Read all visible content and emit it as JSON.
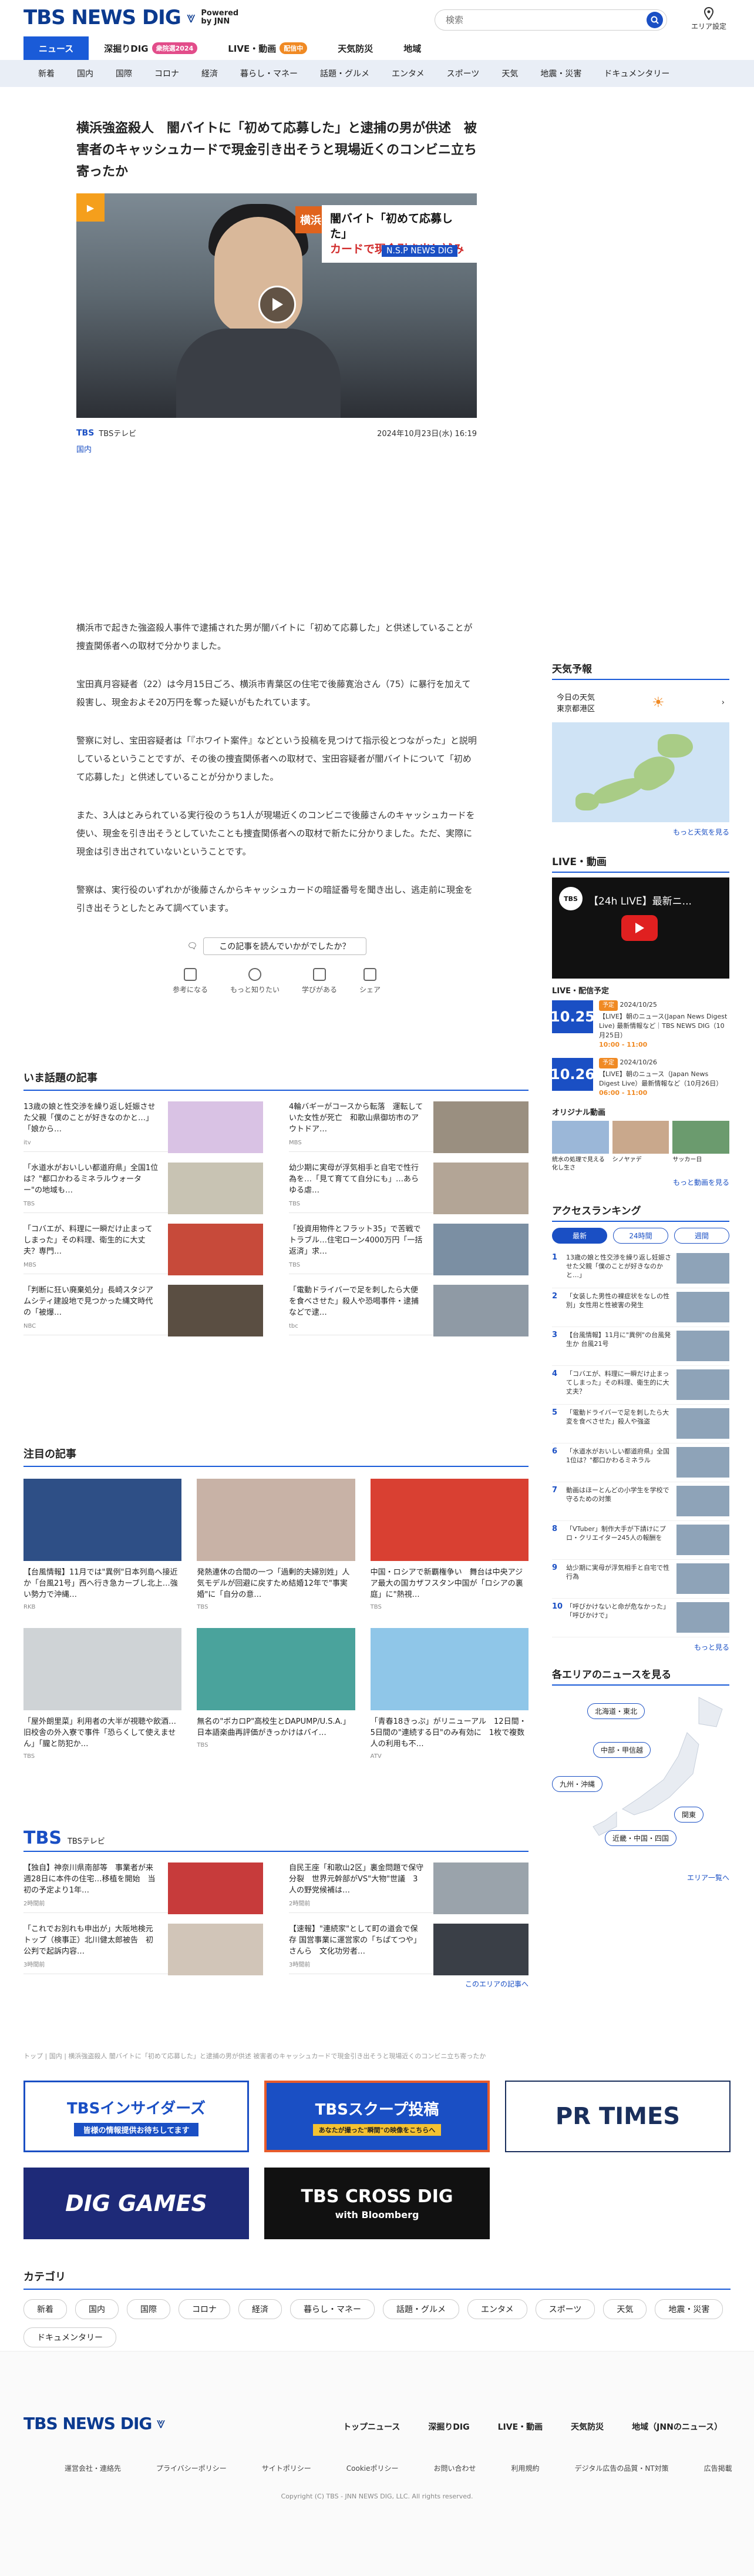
{
  "header": {
    "logo_text": "TBS NEWS DIG",
    "powered": "Powered by JNN",
    "search_placeholder": "検索",
    "area_label": "エリア設定"
  },
  "nav1": [
    {
      "label": "ニュース",
      "badge": ""
    },
    {
      "label": "深掘りDIG",
      "badge": "衆院選2024"
    },
    {
      "label": "LIVE・動画",
      "badge": "配信中"
    },
    {
      "label": "天気防災",
      "badge": ""
    },
    {
      "label": "地域",
      "badge": ""
    }
  ],
  "nav2": [
    "新着",
    "国内",
    "国際",
    "コロナ",
    "経済",
    "暮らし・マネー",
    "話題・グルメ",
    "エンタメ",
    "スポーツ",
    "天気",
    "地震・災害",
    "ドキュメンタリー"
  ],
  "article": {
    "title": "横浜強盗殺人　闇バイトに「初めて応募した」と逮捕の男が供述　被害者のキャッシュカードで現金引き出そうと現場近くのコンビニ立ち寄ったか",
    "hero_caption_line1": "闇バイト「初めて応募した」",
    "hero_caption_line2": "カードで現金引き出し試み",
    "hero_tag": "横浜",
    "hero_ntag": "N.S.P NEWS DIG",
    "source": "TBSテレビ",
    "date": "2024年10月23日(水) 16:19",
    "category": "国内",
    "paragraphs": [
      "横浜市で起きた強盗殺人事件で逮捕された男が闇バイトに「初めて応募した」と供述していることが捜査関係者への取材で分かりました。",
      "宝田真月容疑者（22）は今月15日ごろ、横浜市青葉区の住宅で後藤寛治さん（75）に暴行を加えて殺害し、現金およそ20万円を奪った疑いがもたれています。",
      "警察に対し、宝田容疑者は「『ホワイト案件』などという投稿を見つけて指示役とつながった」と説明しているということですが、その後の捜査関係者への取材で、宝田容疑者が闇バイトについて「初めて応募した」と供述していることが分かりました。",
      "また、3人はとみられている実行役のうち1人が現場近くのコンビニで後藤さんのキャッシュカードを使い、現金を引き出そうとしていたことも捜査関係者への取材で新たに分かりました。ただ、実際に現金は引き出されていないということです。",
      "警察は、実行役のいずれかが後藤さんからキャッシュカードの暗証番号を聞き出し、逃走前に現金を引き出そうとしたとみて調べています。"
    ],
    "feedback_q": "この記事を読んでいかがでしたか？",
    "feedback_opts": [
      "参考になる",
      "もっと知りたい",
      "学びがある",
      "シェア"
    ]
  },
  "sidebar": {
    "weather_h": "天気予報",
    "weather_today": "今日の天気",
    "weather_place": "東京都港区",
    "weather_more": "もっと天気を見る",
    "live_h": "LIVE・動画",
    "live_title": "【24h LIVE】最新ニ...",
    "live_logo": "TBS",
    "sched_h": "LIVE・配信予定",
    "sched": [
      {
        "day": "10.25",
        "pill": "予定",
        "date": "2024/10/25",
        "text": "【LIVE】朝のニュース(Japan News Digest Live) 最新情報など｜TBS NEWS DIG（10月25日）",
        "time": "10:00 - 11:00"
      },
      {
        "day": "10.26",
        "pill": "予定",
        "date": "2024/10/26",
        "text": "【LIVE】朝のニュース（Japan News Digest Live）最新情報など（10月26日）",
        "time": "06:00 - 11:00"
      }
    ],
    "orig_h": "オリジナル動画",
    "orig_caps": [
      "統水の処理で見える化し生さ",
      "シノヤァデ",
      "サッカー日"
    ],
    "orig_more": "もっと動画を見る",
    "rank_h": "アクセスランキング",
    "rank_tabs": [
      "最新",
      "24時間",
      "週間"
    ],
    "rank": [
      "13歳の娘と性交渉を繰り返し妊娠させた父親「僕のことが好きなのかと…」",
      "「女装した男性の裸症状をなしの性別」女性用と性被害の発生",
      "【台風情報】11月に\"異例\"の台風発生か 台風21号",
      "「コバエが、料理に一瞬だけ止まってしまった」その料理、衛生的に大丈夫？",
      "「電動ドライバーで足を刺したら大変を食べさせた」殺人や強盗",
      "「水道水がおいしい都道府県」全国1位は？\"都口かわるミネラル",
      "動画はほーとんどの小学生を学校で守るための対策",
      "「VTuber」制作大手が下請けにプロ・クリエイター245人の報酬を",
      "幼少期に実母が浮気相手と自宅で性行為",
      "「呼びかけないと命が危なかった」「呼びかけで」"
    ],
    "rank_more": "もっと見る",
    "area_h": "各エリアのニュースを見る",
    "areas": [
      "北海道・東北",
      "中部・甲信越",
      "九州・沖縄",
      "関東",
      "近畿・中国・四国"
    ],
    "area_more": "エリア一覧へ"
  },
  "topics": {
    "h": "いま話題の記事",
    "items": [
      {
        "t": "13歳の娘と性交渉を繰り返し妊娠させた父親「僕のことが好きなのかと…」「娘から…",
        "s": "itv"
      },
      {
        "t": "4輪バギーがコースから転落　運転していた女性が死亡　和歌山県御坊市のアウトドア…",
        "s": "MBS"
      },
      {
        "t": "「水道水がおいしい都道府県」全国1位は？\"都口かわるミネラルウォーター\"の地域も…",
        "s": "TBS"
      },
      {
        "t": "幼少期に実母が浮気相手と自宅で性行為を…「見て育てて自分にも」…あらゆる虐…",
        "s": "TBS"
      },
      {
        "t": "「コバエが、料理に一瞬だけ止まってしまった」その料理、衛生的に大丈夫？専門…",
        "s": "MBS"
      },
      {
        "t": "「投資用物件とフラット35」で苦戦でトラブル…住宅ローン4000万円「一括返済」求…",
        "s": "TBS"
      },
      {
        "t": "「判断に狂い廃棄処分」長崎スタジアムシティ建設地で見つかった縄文時代の「被爆…",
        "s": "NBC"
      },
      {
        "t": "「電動ドライバーで足を刺したら大便を食べさせた」殺人や恐喝事件・逮捕などで逮…",
        "s": "tbc"
      }
    ]
  },
  "featured": {
    "h": "注目の記事",
    "items": [
      {
        "t": "【台風情報】11月では\"異例\"日本列島へ接近か「台風21号」西へ行き急カーブし北上…強い勢力で沖縄…",
        "s": "RKB"
      },
      {
        "t": "発熱連休の合間の一つ「過剰的夫婦別姓」人気モデルが回避に戻すため結婚12年で\"事実婚\"に「自分の意…",
        "s": "TBS"
      },
      {
        "t": "中国・ロシアで新覇権争い　舞台は中央アジア最大の国カザフスタン中国が「ロシアの裏庭」に\"熱視…",
        "s": "TBS"
      },
      {
        "t": "「屋外朗里菜」利用者の大半が視聴や飲酒…旧校舎の外入寮で事件「恐らくして使えません」「朧と防犯か…",
        "s": "TBS"
      },
      {
        "t": "無名の\"ボカロP\"高校生とDAPUMP/U.S.A.」日本語楽曲再評価がきっかけはバイ…",
        "s": "TBS"
      },
      {
        "t": "「青春18きっぷ」がリニューアル　12日間・5日間の\"連続する日\"のみ有効に　1枚で複数人の利用も不…",
        "s": "ATV"
      }
    ]
  },
  "tbs_sec": {
    "logo": "TBS",
    "sub": "TBSテレビ",
    "items": [
      {
        "t": "【独自】神奈川県南部等　事業者が来週28日に本件の住宅…移植を開始　当初の予定より1年…",
        "d": "2時間前"
      },
      {
        "t": "自民王座「和歌山2区」裏金問題で保守分裂　世界元幹部がVS\"大物\"世議　3人の野党候補は…",
        "d": "2時間前"
      },
      {
        "t": "「これでお別れも申出が」大阪地検元トップ（検事正）北川健太郎被告　初公判で起訴内容…",
        "d": "3時間前"
      },
      {
        "t": "【速報】\"連続家\"として町の道会で保存 国営事業に運営家の「ちぱてつや」さんら　文化功労者…",
        "d": "3時間前"
      }
    ],
    "more": "このエリアの記事へ"
  },
  "breadcrumb": "トップ | 国内 | 横浜強盗殺人 闇バイトに「初めて応募した」と逮捕の男が供述 被害者のキャッシュカードで現金引き出そうと現場近くのコンビニ立ち寄ったか",
  "banners": [
    {
      "label": "TBSインサイダーズ",
      "sub": "皆様の情報提供お待ちしてます"
    },
    {
      "label": "TBSスクープ投稿",
      "sub": "あなたが撮った\"瞬間\"の映像をこちらへ"
    },
    {
      "label": "PR TIMES",
      "sub": ""
    },
    {
      "label": "DIG GAMES",
      "sub": ""
    },
    {
      "label": "TBS CROSS DIG",
      "sub": "with Bloomberg"
    }
  ],
  "categories": {
    "h": "カテゴリ",
    "items": [
      "新着",
      "国内",
      "国際",
      "コロナ",
      "経済",
      "暮らし・マネー",
      "話題・グルメ",
      "エンタメ",
      "スポーツ",
      "天気",
      "地震・災害",
      "ドキュメンタリー"
    ]
  },
  "footer": {
    "nav": [
      "トップニュース",
      "深掘りDIG",
      "LIVE・動画",
      "天気防災",
      "地域（JNNのニュース）"
    ],
    "links": [
      "運営会社・連絡先",
      "プライバシーポリシー",
      "サイトポリシー",
      "Cookieポリシー",
      "お問い合わせ",
      "利用規約",
      "デジタル広告の品質・NT対策",
      "広告掲載"
    ],
    "copyright": "Copyright (C) TBS - JNN NEWS DIG, LLC. All rights reserved."
  },
  "colors": {
    "brand": "#0b3a8f",
    "accent": "#1a5bd8",
    "badge_pink": "#e24d8a",
    "badge_orange": "#f08a24"
  }
}
